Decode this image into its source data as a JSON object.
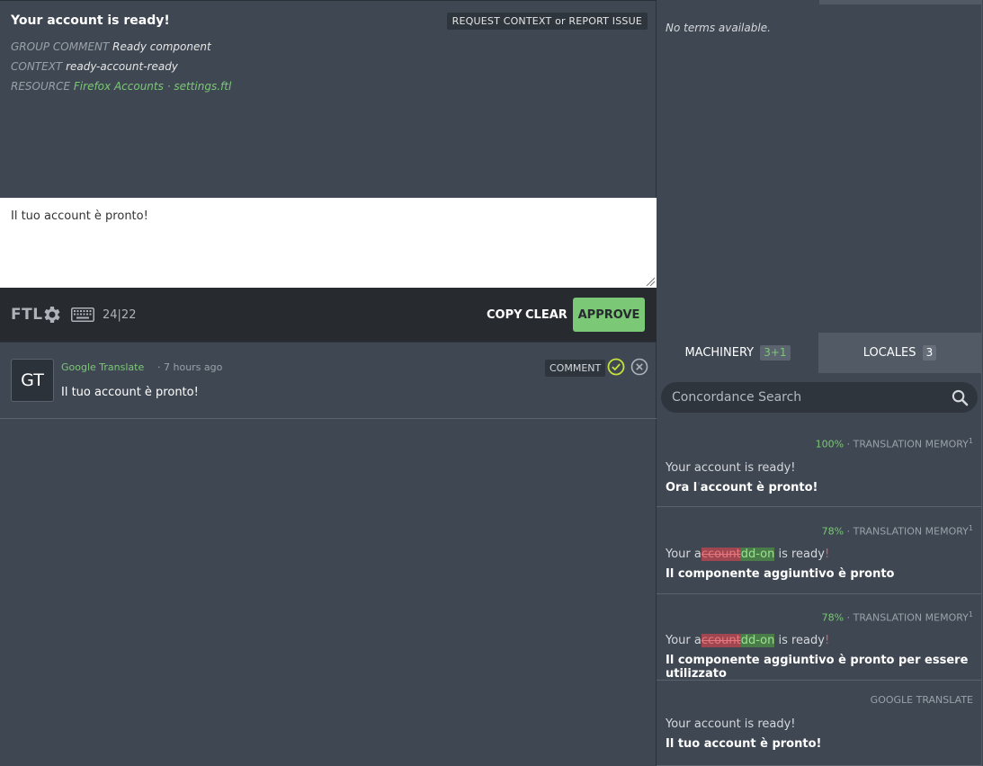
{
  "original": {
    "title": "Your account is ready!",
    "request_context": "REQUEST CONTEXT or REPORT ISSUE",
    "group_comment_label": "GROUP COMMENT",
    "group_comment_value": "Ready component",
    "context_label": "CONTEXT",
    "context_value": "ready-account-ready",
    "resource_label": "RESOURCE",
    "resource_project": "Firefox Accounts",
    "resource_sep": "·",
    "resource_file": "settings.ftl"
  },
  "editor": {
    "value": "Il tuo account è pronto!",
    "ftl_label": "FTL",
    "char_count": "24|22",
    "copy_label": "COPY",
    "clear_label": "CLEAR",
    "approve_label": "APPROVE"
  },
  "history": {
    "avatar": "GT",
    "author": "Google Translate",
    "meta": "· 7 hours ago",
    "text": "Il tuo account è pronto!",
    "comment_label": "COMMENT"
  },
  "terms": {
    "empty_text": "No terms available."
  },
  "tabs": {
    "machinery_label": "MACHINERY",
    "machinery_count": "3+1",
    "locales_label": "LOCALES",
    "locales_count": "3"
  },
  "search": {
    "placeholder": "Concordance Search"
  },
  "machinery": {
    "entries": [
      {
        "percent": "100%",
        "source_label": "· TRANSLATION MEMORY",
        "sup": "1",
        "original": "Your account is ready!",
        "translation_a": "Ora l",
        "translation_b": "'",
        "translation_c": "account è pronto!"
      },
      {
        "percent": "78%",
        "source_label": "· TRANSLATION MEMORY",
        "sup": "1",
        "orig_pre": "Your a",
        "orig_del": "ccount",
        "orig_ins": "dd-on",
        "orig_post": " is ready",
        "orig_end": "!",
        "translation": "Il componente aggiuntivo è pronto"
      },
      {
        "percent": "78%",
        "source_label": "· TRANSLATION MEMORY",
        "sup": "1",
        "orig_pre": "Your a",
        "orig_del": "ccount",
        "orig_ins": "dd-on",
        "orig_post": " is ready",
        "orig_end": "!",
        "translation": "Il componente aggiuntivo è pronto per essere utilizzato"
      },
      {
        "source_label": "GOOGLE TRANSLATE",
        "original": "Your account is ready!",
        "translation": "Il tuo account è pronto!"
      }
    ]
  },
  "colors": {
    "accent_green": "#7bc876",
    "background": "#3f4752",
    "toolbar": "#272a2f"
  }
}
